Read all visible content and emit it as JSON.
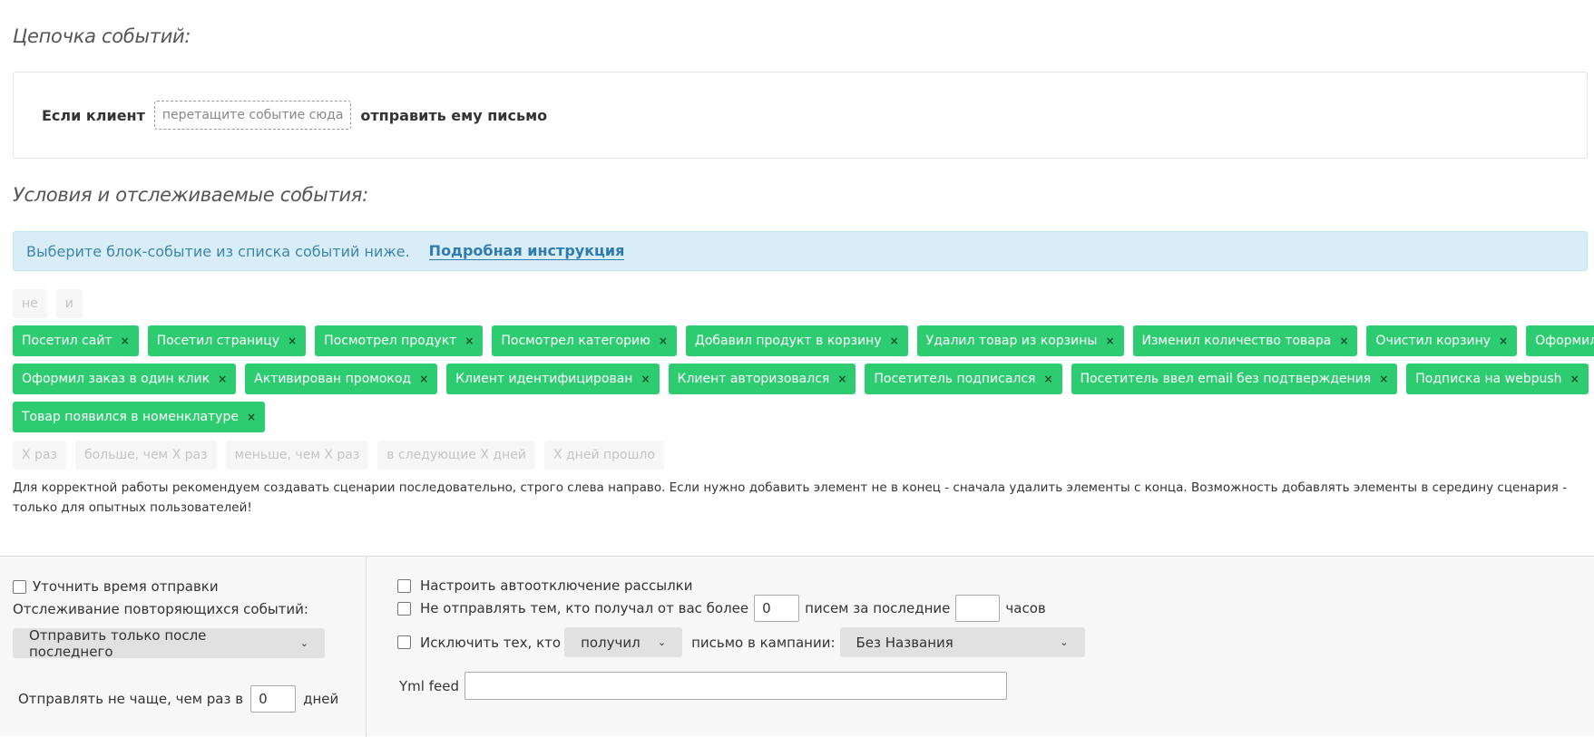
{
  "chain": {
    "title": "Цепочка событий:",
    "if_client": "Если клиент",
    "dropzone": "перетащите событие сюда",
    "send_letter": "отправить ему письмо"
  },
  "conditions": {
    "title": "Условия и отслеживаемые события:",
    "info_text": "Выберите блок-событие из списка событий ниже.",
    "info_link": "Подробная инструкция"
  },
  "logic_tags": [
    "не",
    "и"
  ],
  "event_tags_row1": [
    "Посетил сайт",
    "Посетил страницу",
    "Посмотрел продукт",
    "Посмотрел категорию",
    "Добавил продукт в корзину",
    "Удалил товар из корзины",
    "Изменил количество товара",
    "Очистил корзину",
    "Оформил заказ"
  ],
  "event_tags_row2": [
    "Оформил заказ в один клик",
    "Активирован промокод",
    "Клиент идентифицирован",
    "Клиент авторизовался",
    "Посетитель подписался",
    "Посетитель ввел email без подтверждения",
    "Подписка на webpush"
  ],
  "event_tags_row3": [
    "Товар появился в номенклатуре"
  ],
  "remove_symbol": "×",
  "quantifier_tags": [
    "X раз",
    "больше, чем X раз",
    "меньше, чем X раз",
    "в следующие X дней",
    "X дней прошло"
  ],
  "note": "Для корректной работы рекомендуем создавать сценарии последовательно, строго слева направо. Если нужно добавить элемент не в конец - сначала удалить элементы с конца. Возможность добавлять элементы в середину сценария - только для опытных пользователей!",
  "left_panel": {
    "specify_time": "Уточнить время отправки",
    "repeat_label": "Отслеживание повторяющихся событий:",
    "repeat_select": "Отправить только после последнего",
    "freq_prefix": "Отправлять не чаще, чем раз в",
    "freq_value": "0",
    "freq_suffix": "дней"
  },
  "right_panel": {
    "auto_off": "Настроить автоотключение рассылки",
    "dont_send_prefix": "Не отправлять тем, кто получал от вас более",
    "dont_send_value": "0",
    "dont_send_mid": "писем за последние",
    "dont_send_hours": "",
    "dont_send_suffix": "часов",
    "exclude_prefix": "Исключить тех, кто",
    "exclude_select": "получил",
    "exclude_mid": "письмо в кампании:",
    "campaign_select": "Без Названия",
    "yml_label": "Yml feed",
    "yml_value": ""
  },
  "colors": {
    "tag_green": "#2ecc71",
    "info_bg": "#d9edf7",
    "info_link": "#2f7bb0"
  }
}
